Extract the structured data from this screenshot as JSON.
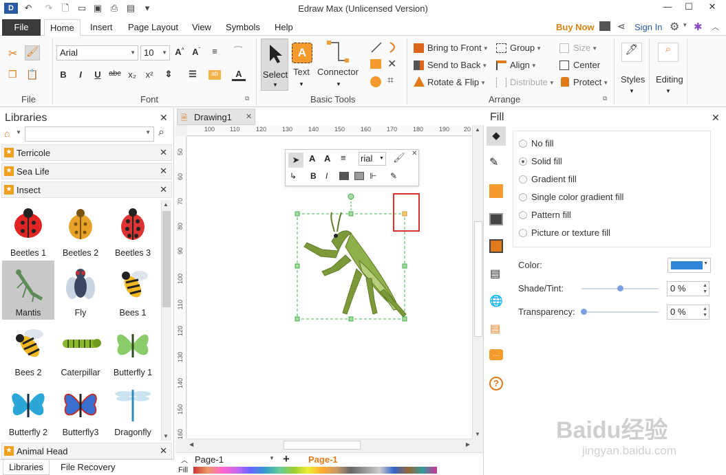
{
  "window": {
    "title": "Edraw Max (Unlicensed Version)"
  },
  "menu": {
    "file": "File",
    "tabs": [
      "Home",
      "Insert",
      "Page Layout",
      "View",
      "Symbols",
      "Help"
    ],
    "buy_now": "Buy Now",
    "sign_in": "Sign In"
  },
  "ribbon": {
    "file_group": "File",
    "font_group": "Font",
    "font_name": "Arial",
    "font_size": "10",
    "basic_tools_group": "Basic Tools",
    "select": "Select",
    "text": "Text",
    "connector": "Connector",
    "arrange_group": "Arrange",
    "bring_to_front": "Bring to Front",
    "send_to_back": "Send to Back",
    "rotate_flip": "Rotate & Flip",
    "group": "Group",
    "align": "Align",
    "distribute": "Distribute",
    "size": "Size",
    "center": "Center",
    "protect": "Protect",
    "styles": "Styles",
    "editing": "Editing"
  },
  "libraries": {
    "title": "Libraries",
    "sections": [
      "Terricole",
      "Sea Life",
      "Insect",
      "Animal Head"
    ],
    "items": [
      "Beetles 1",
      "Beetles 2",
      "Beetles 3",
      "Mantis",
      "Fly",
      "Bees 1",
      "Bees 2",
      "Caterpillar",
      "Butterfly 1",
      "Butterfly 2",
      "Butterfly3",
      "Dragonfly"
    ],
    "bottom_tabs": [
      "Libraries",
      "File Recovery"
    ]
  },
  "document": {
    "tab": "Drawing1",
    "ruler_h": [
      "100",
      "110",
      "120",
      "130",
      "140",
      "150",
      "160",
      "170",
      "180",
      "190",
      "20"
    ],
    "ruler_v": [
      "50",
      "60",
      "70",
      "80",
      "90",
      "100",
      "110",
      "120",
      "130",
      "140",
      "150",
      "160"
    ],
    "float_font": "rial",
    "page_select": "Page-1",
    "page_tab": "Page-1",
    "fill_label": "Fill"
  },
  "fill_panel": {
    "title": "Fill",
    "options": [
      "No fill",
      "Solid fill",
      "Gradient fill",
      "Single color gradient fill",
      "Pattern fill",
      "Picture or texture fill"
    ],
    "selected": "Solid fill",
    "color_label": "Color:",
    "color_value": "#2f86d8",
    "shade_label": "Shade/Tint:",
    "shade_value": "0 %",
    "transparency_label": "Transparency:",
    "transparency_value": "0 %"
  },
  "watermark": {
    "text": "Baidu经验",
    "url": "jingyan.baidu.com"
  },
  "colors": {
    "accent_orange": "#f0a020",
    "selection_green": "#3cb44b",
    "highlight_red": "#d9302c"
  }
}
